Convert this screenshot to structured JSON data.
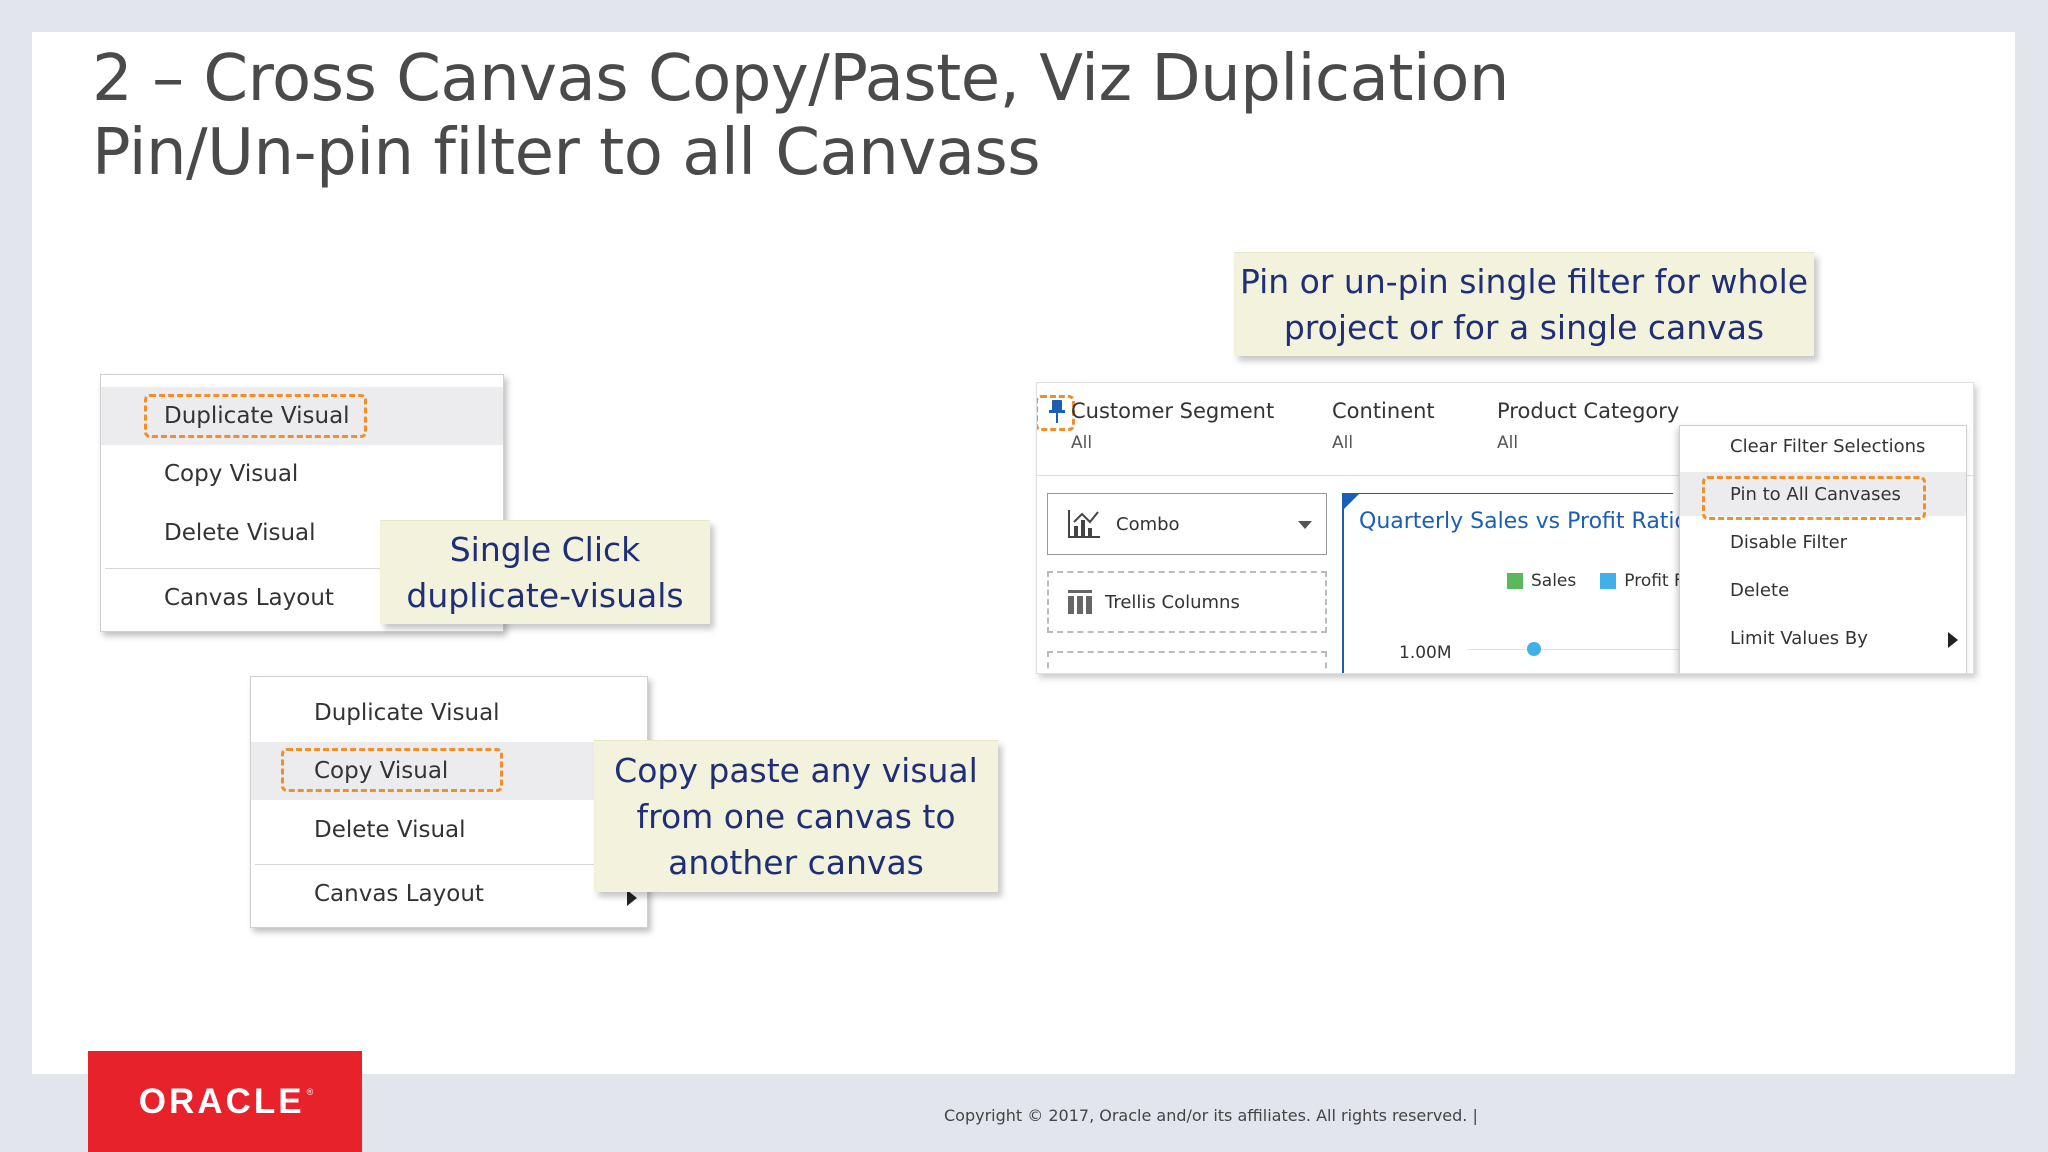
{
  "title": {
    "line1": "2 – Cross Canvas Copy/Paste,  Viz Duplication",
    "line2": "Pin/Un-pin filter to all Canvass"
  },
  "callouts": {
    "pin": [
      "Pin or un-pin single filter for whole",
      "project or for a single canvas"
    ],
    "single_click": [
      "Single Click",
      "duplicate-visuals"
    ],
    "copy_paste": [
      "Copy paste any visual",
      "from one canvas to",
      "another canvas"
    ]
  },
  "menu1": {
    "items": [
      "Duplicate Visual",
      "Copy Visual",
      "Delete Visual",
      "Canvas Layout"
    ]
  },
  "menu2": {
    "items": [
      "Duplicate Visual",
      "Copy Visual",
      "Delete Visual",
      "Canvas Layout"
    ]
  },
  "filter_bar": {
    "filters": [
      {
        "name": "Customer Segment",
        "value": "All"
      },
      {
        "name": "Continent",
        "value": "All"
      },
      {
        "name": "Product Category",
        "value": "All"
      }
    ],
    "viz_type": "Combo",
    "trellis": "Trellis Columns",
    "chart_title": "Quarterly Sales vs Profit Ratio",
    "legend": [
      {
        "name": "Sales",
        "color": "#5cb85c"
      },
      {
        "name": "Profit F",
        "color": "#3fb0e8"
      }
    ],
    "y_tick": "1.00M",
    "context_menu": [
      "Clear Filter Selections",
      "Pin to All Canvases",
      "Disable Filter",
      "Delete",
      "Limit Values By"
    ]
  },
  "accent_color": "#f0902a",
  "text_color": "#1f2e78",
  "footer": {
    "copyright": "Copyright © 2017, Oracle and/or its affiliates. All rights reserved.  |",
    "logo": "ORACLE"
  }
}
